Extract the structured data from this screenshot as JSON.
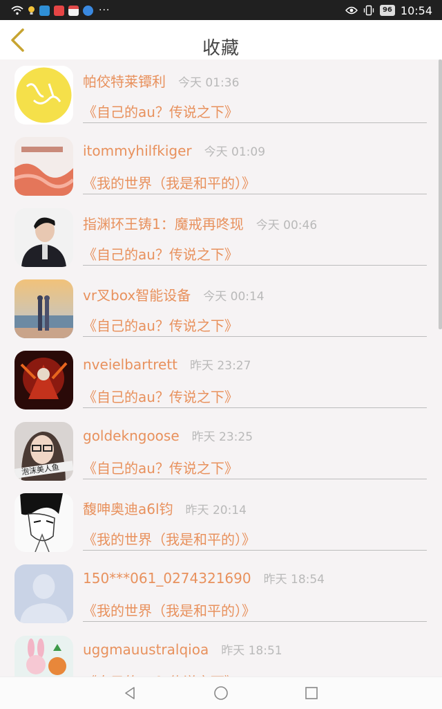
{
  "status_bar": {
    "time": "10:54",
    "battery": "96",
    "left_icons": [
      "wifi-icon",
      "bulb-icon",
      "app-icon-blue",
      "app-icon-red",
      "app-icon-gift",
      "app-icon-k"
    ],
    "overflow": "···",
    "right_icons": [
      "eye-icon",
      "vibrate-icon",
      "battery-icon"
    ]
  },
  "header": {
    "title": "收藏",
    "back_icon": "chevron-left-icon"
  },
  "colors": {
    "accent": "#e8915d",
    "back_arrow": "#c7a431",
    "time_gray": "#b9b9b9"
  },
  "items": [
    {
      "name": "帕佼特莱镡利",
      "time": "今天 01:36",
      "book": "《自己的au？传说之下》",
      "avatar": "yellow-calligraphy-avatar"
    },
    {
      "name": "itommyhilfkiger",
      "time": "今天 01:09",
      "book": "《我的世界（我是和平的）》",
      "avatar": "coral-artwork-avatar"
    },
    {
      "name": "指渊环王铸1：魔戒再咚现",
      "time": "今天 00:46",
      "book": "《自己的au？传说之下》",
      "avatar": "man-portrait-avatar"
    },
    {
      "name": "vr叉box智能设备",
      "time": "今天 00:14",
      "book": "《自己的au？传说之下》",
      "avatar": "beach-couple-avatar"
    },
    {
      "name": "nveielbartrett",
      "time": "昨天 23:27",
      "book": "《自己的au？传说之下》",
      "avatar": "red-warrior-avatar"
    },
    {
      "name": "goldekngoose",
      "time": "昨天 23:25",
      "book": "《自己的au？传说之下》",
      "avatar": "girl-selfie-avatar",
      "caption": "泡沫美人鱼"
    },
    {
      "name": "馥呻奥迪a6l钧",
      "time": "昨天 20:14",
      "book": "《我的世界（我是和平的）》",
      "avatar": "manga-sketch-avatar"
    },
    {
      "name": "150***061_0274321690",
      "time": "昨天 18:54",
      "book": "《我的世界（我是和平的）》",
      "avatar": "default-user-avatar"
    },
    {
      "name": "uggmauustralqioa",
      "time": "昨天 18:51",
      "book": "《自己的au？传说之下》",
      "avatar": "toy-figures-avatar"
    }
  ],
  "nav_bar": {
    "icons": [
      "back-triangle-icon",
      "home-circle-icon",
      "recents-square-icon"
    ]
  }
}
